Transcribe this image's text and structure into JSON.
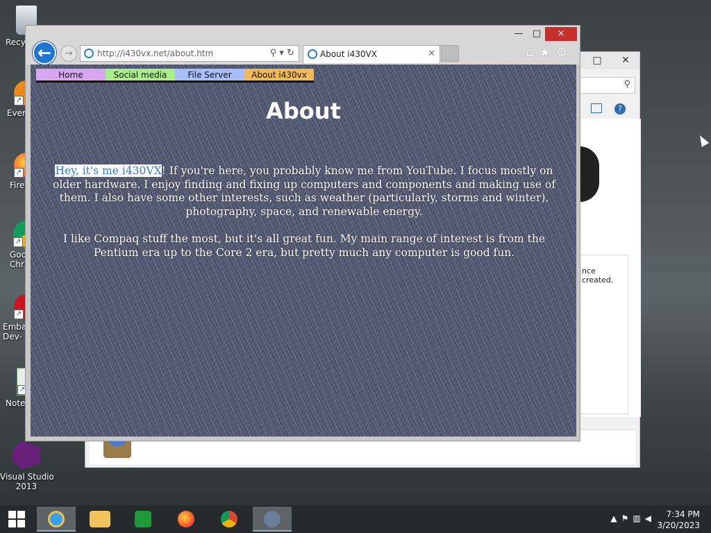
{
  "desktop": {
    "icons": [
      {
        "label": "Recyc",
        "icon": "recycle-bin-icon"
      },
      {
        "label": "Every",
        "icon": "everything-app-icon"
      },
      {
        "label": "Fire",
        "icon": "firefox-icon"
      },
      {
        "label": "Goo\nChr",
        "icon": "chrome-icon"
      },
      {
        "label": "Embar\nDev-",
        "icon": "embarcadero-icon"
      },
      {
        "label": "Notep",
        "icon": "notepad-icon"
      },
      {
        "label": "Visual Studio\n2013",
        "icon": "visual-studio-icon"
      }
    ]
  },
  "bg_window": {
    "panel_text_1": "nce",
    "panel_text_2": "created."
  },
  "ie": {
    "address": "http://i430vx.net/about.htm",
    "tab_title": "About i430VX",
    "close_glyph": "×",
    "minimize_glyph": "—",
    "maximize_glyph": "□"
  },
  "site": {
    "nav": [
      {
        "label": "Home"
      },
      {
        "label": "Social media"
      },
      {
        "label": "File Server"
      },
      {
        "label": "About i430vx"
      }
    ],
    "heading": "About",
    "para1_highlight": "Hey, it's me i430VX",
    "para1_rest": "! If you're here, you probably know me from YouTube. I focus mostly on older hardware. I enjoy finding and fixing up computers and components and making use of them. I also have some other interests, such as weather (particularly, storms and winter), photography, space, and renewable energy.",
    "para2": "I like Compaq stuff the most, but it's all great fun. My main range of interest is from the Pentium era up to the Core 2 era, but pretty much any computer is good fun."
  },
  "taskbar": {
    "apps": [
      "internet-explorer",
      "file-explorer",
      "store",
      "firefox",
      "chrome",
      "ie-pinned"
    ],
    "time": "7:34 PM",
    "date": "3/20/2023"
  }
}
